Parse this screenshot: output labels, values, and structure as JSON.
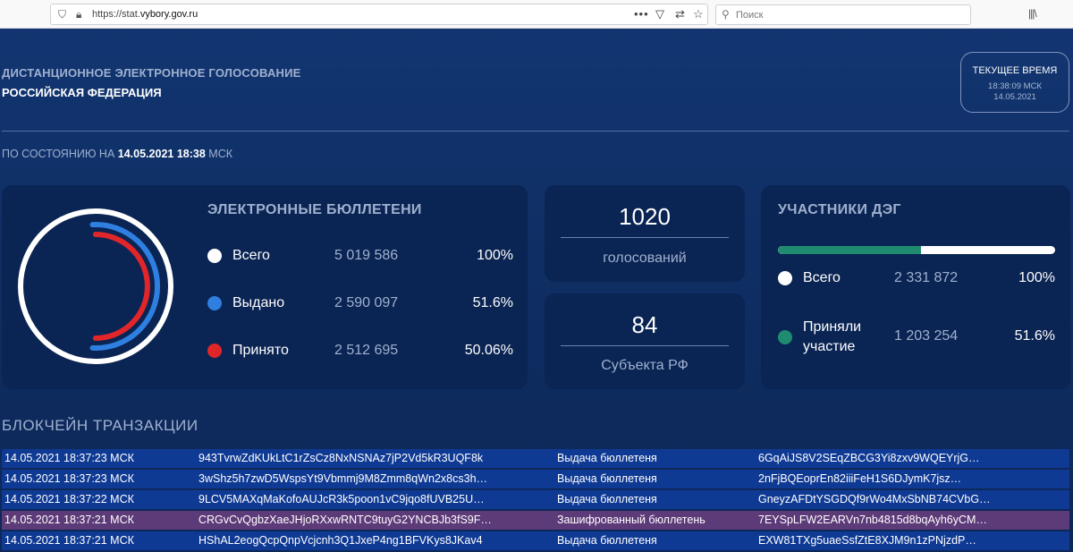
{
  "browser": {
    "url_prefix": "https://stat.",
    "url_domain": "vybory.gov.ru",
    "search_placeholder": "Поиск",
    "icons": [
      "shield-icon",
      "lock-icon",
      "more-icon",
      "pocket-icon",
      "translate-icon",
      "bookmark-star-icon",
      "search-icon",
      "library-icon"
    ]
  },
  "header": {
    "subtitle": "ДИСТАНЦИОННОЕ ЭЛЕКТРОННОЕ ГОЛОСОВАНИЕ",
    "title": "РОССИЙСКАЯ ФЕДЕРАЦИЯ"
  },
  "clock": {
    "label": "ТЕКУЩЕЕ ВРЕМЯ",
    "time": "18:38:09 МСК",
    "date": "14.05.2021"
  },
  "as_of": {
    "prefix": "ПО СОСТОЯНИЮ НА",
    "datetime": "14.05.2021 18:38",
    "suffix": "МСК"
  },
  "ballots": {
    "title": "ЭЛЕКТРОННЫЕ БЮЛЛЕТЕНИ",
    "rows": [
      {
        "label": "Всего",
        "value": "5 019 586",
        "percent": "100%",
        "color": "#ffffff",
        "fraction": 1.0
      },
      {
        "label": "Выдано",
        "value": "2 590 097",
        "percent": "51.6%",
        "color": "#2f7fe0",
        "fraction": 0.516
      },
      {
        "label": "Принято",
        "value": "2 512 695",
        "percent": "50.06%",
        "color": "#e1262a",
        "fraction": 0.5006
      }
    ]
  },
  "stats": {
    "votes_value": "1020",
    "votes_caption": "голосований",
    "regions_value": "84",
    "regions_caption": "Субъекта РФ"
  },
  "participants": {
    "title": "УЧАСТНИКИ ДЭГ",
    "progress_fraction": 0.516,
    "accent": "#1f8c6f",
    "rows": [
      {
        "label": "Всего",
        "value": "2 331 872",
        "percent": "100%",
        "color": "#ffffff"
      },
      {
        "label_line1": "Приняли",
        "label_line2": "участие",
        "value": "1 203 254",
        "percent": "51.6%",
        "color": "#1f8c6f"
      }
    ]
  },
  "blockchain": {
    "title": "БЛОКЧЕЙН ТРАНЗАКЦИИ",
    "rows": [
      {
        "time": "14.05.2021 18:37:23 МСК",
        "hash": "943TvrwZdKUkLtC1rZsCz8NxNSNAz7jP2Vd5kR3UQF8k",
        "type": "Выдача бюллетеня",
        "id": "6GqAiJS8V2SEqZBCG3Yi8zxv9WQEYrjG…",
        "encrypted": false
      },
      {
        "time": "14.05.2021 18:37:23 МСК",
        "hash": "3wShz5h7zwD5WspsYt9Vbmmj9M8Zmm8qWn2x8cs3h…",
        "type": "Выдача бюллетеня",
        "id": "2nFjBQEoprEn82iiiFeH1S6DJymK7jsz…",
        "encrypted": false
      },
      {
        "time": "14.05.2021 18:37:22 МСК",
        "hash": "9LCV5MAXqMaKofoAUJcR3k5poon1vC9jqo8fUVB25U…",
        "type": "Выдача бюллетеня",
        "id": "GneyzAFDtYSGDQf9rWo4MxSbNB74CVbG…",
        "encrypted": false
      },
      {
        "time": "14.05.2021 18:37:21 МСК",
        "hash": "CRGvCvQgbzXaeJHjoRXxwRNTC9tuyG2YNCBJb3fS9F…",
        "type": "Зашифрованный бюллетень",
        "id": "7EYSpLFW2EARVn7nb4815d8bqAyh6yCM…",
        "encrypted": true
      },
      {
        "time": "14.05.2021 18:37:21 МСК",
        "hash": "HShAL2eogQcpQnpVcjcnh3Q1JxeP4ng1BFVKys8JKav4",
        "type": "Выдача бюллетеня",
        "id": "EXW81TXg5uaeSsfZtE8XJM9n1zPNjzdP…",
        "encrypted": false
      }
    ]
  }
}
